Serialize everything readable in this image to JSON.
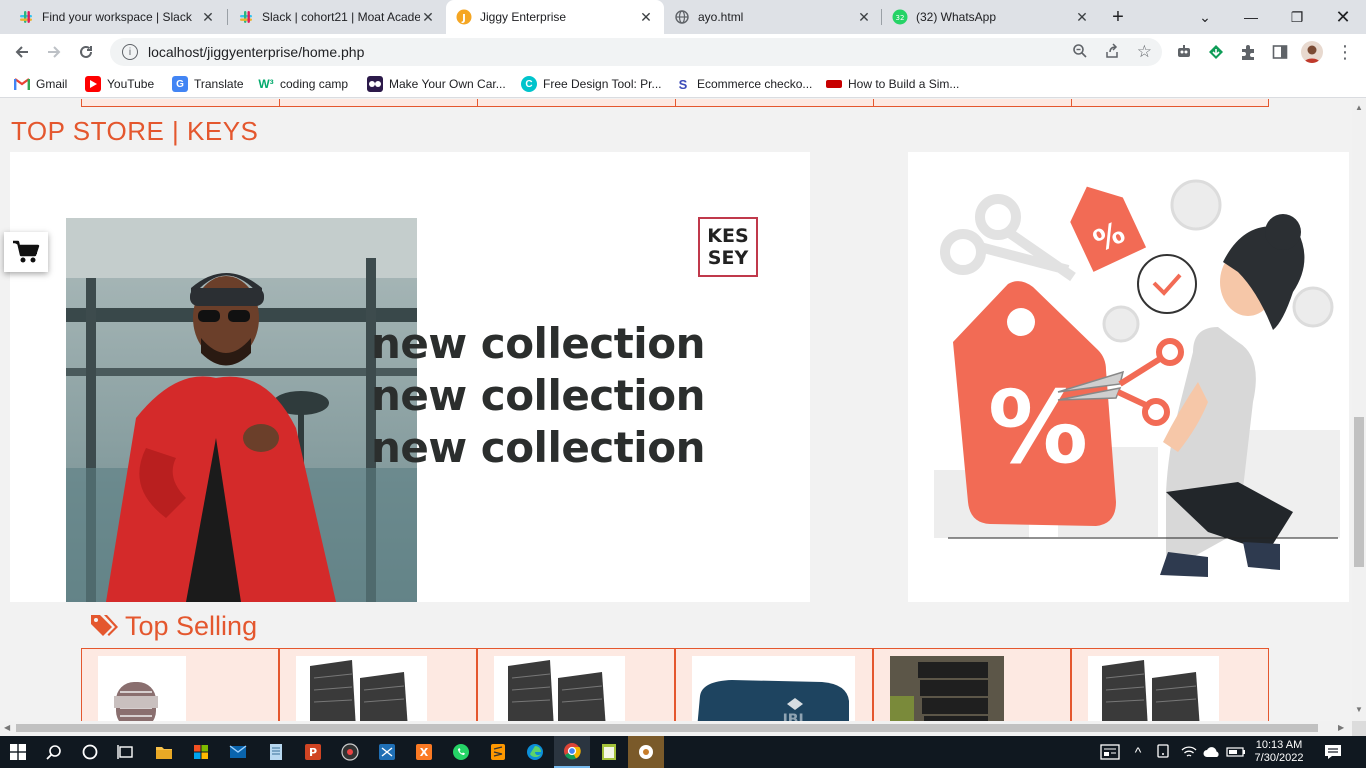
{
  "browser": {
    "tabs": [
      {
        "title": "Find your workspace | Slack",
        "icon": "slack-icon",
        "active": false
      },
      {
        "title": "Slack | cohort21 | Moat Acade",
        "icon": "slack-icon",
        "active": false
      },
      {
        "title": "Jiggy Enterprise",
        "icon": "jiggy-icon",
        "active": true
      },
      {
        "title": "ayo.html",
        "icon": "globe-icon",
        "active": false
      },
      {
        "title": "(32) WhatsApp",
        "icon": "whatsapp-icon",
        "active": false
      }
    ],
    "new_tab_label": "+",
    "url": "localhost/jiggyenterprise/home.php",
    "bookmarks": [
      {
        "label": "Gmail",
        "icon": "gmail-icon"
      },
      {
        "label": "YouTube",
        "icon": "youtube-icon"
      },
      {
        "label": "Translate",
        "icon": "translate-icon"
      },
      {
        "label": "coding camp",
        "icon": "w3-icon"
      },
      {
        "label": "Make Your Own Car...",
        "icon": "flickr-icon"
      },
      {
        "label": "Free Design Tool: Pr...",
        "icon": "canva-icon"
      },
      {
        "label": "Ecommerce checko...",
        "icon": "stripe-icon"
      },
      {
        "label": "How to Build a Sim...",
        "icon": "bookmark-red-icon"
      }
    ]
  },
  "page": {
    "store_heading": "TOP STORE | KEYS",
    "banner": {
      "brand_line1": "KES",
      "brand_line2": "SEY",
      "headline": [
        "new collection",
        "new collection",
        "new collection"
      ]
    },
    "top_selling_label": "Top Selling",
    "products": [
      {
        "image": "microphone"
      },
      {
        "image": "speakers"
      },
      {
        "image": "speakers"
      },
      {
        "image": "jbl-speaker"
      },
      {
        "image": "speaker-stack"
      },
      {
        "image": "speakers"
      }
    ],
    "colors": {
      "accent": "#e4572e",
      "cell_bg": "#fde9e2",
      "promo_tag": "#f26b55"
    },
    "promo_symbols": {
      "tag_big": "%",
      "tag_small": "%"
    }
  },
  "taskbar": {
    "time": "10:13 AM",
    "date": "7/30/2022",
    "whatsapp_badge": "32"
  }
}
